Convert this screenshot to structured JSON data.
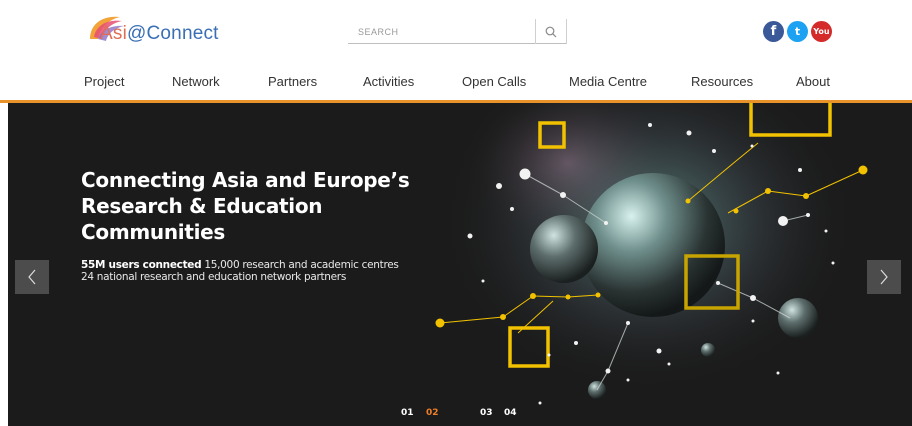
{
  "brand": {
    "logo_part1": "Asi",
    "logo_part2": "@Connect",
    "colors": {
      "accent": "#e8922a",
      "logo_orange": "#e06e54",
      "logo_blue": "#3a6fb5"
    }
  },
  "search": {
    "placeholder": "SEARCH",
    "icon": "search-icon"
  },
  "social": {
    "facebook": {
      "glyph": "f",
      "icon": "facebook-icon",
      "color": "#3b5998"
    },
    "twitter": {
      "glyph": "t",
      "icon": "twitter-icon",
      "color": "#1da1f2"
    },
    "youtube": {
      "glyph": "You",
      "icon": "youtube-icon",
      "color": "#d42a2a"
    }
  },
  "nav": {
    "items": [
      {
        "label": "Project"
      },
      {
        "label": "Network"
      },
      {
        "label": "Partners"
      },
      {
        "label": "Activities"
      },
      {
        "label": "Open Calls"
      },
      {
        "label": "Media Centre"
      },
      {
        "label": "Resources"
      },
      {
        "label": "About"
      }
    ]
  },
  "hero": {
    "headline_line1": "Connecting Asia and Europe’s",
    "headline_line2": "Research & Education",
    "headline_line3": "Communities",
    "sub_bold": "55M users connected",
    "sub_rest": " 15,000 research and academic centres",
    "sub_line2": "24 national research and education network partners",
    "prev_icon": "chevron-left-icon",
    "next_icon": "chevron-right-icon",
    "slides": [
      {
        "label": "01",
        "active": false
      },
      {
        "label": "02",
        "active": true
      },
      {
        "label": "03",
        "active": false
      },
      {
        "label": "04",
        "active": false
      }
    ],
    "colors": {
      "active_slide": "#f07f2a",
      "node_yellow": "#f2c200"
    }
  }
}
